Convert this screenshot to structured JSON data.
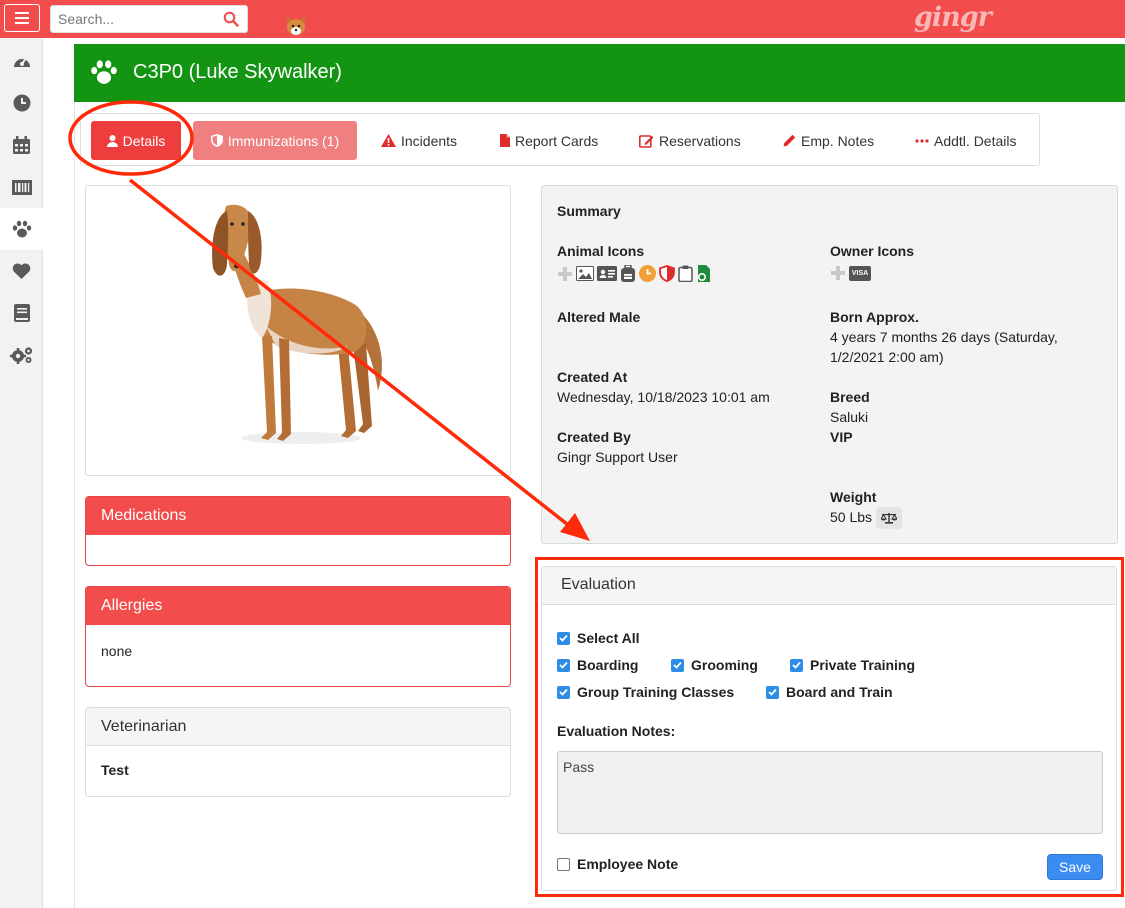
{
  "topbar": {
    "search_placeholder": "Search...",
    "logo_text": "gingr",
    "accent_color": "#f24c4c"
  },
  "sidebar": {
    "items": [
      {
        "icon": "dashboard-icon"
      },
      {
        "icon": "clock-icon"
      },
      {
        "icon": "calendar-icon"
      },
      {
        "icon": "barcode-icon"
      },
      {
        "icon": "paw-icon",
        "active": true
      },
      {
        "icon": "heart-icon"
      },
      {
        "icon": "book-icon"
      },
      {
        "icon": "gears-icon"
      }
    ]
  },
  "header": {
    "title": "C3P0 (Luke Skywalker)",
    "color": "#139513"
  },
  "tabs": [
    {
      "label": "Details",
      "icon": "user-icon",
      "active": true
    },
    {
      "label": "Immunizations (1)",
      "icon": "shield-icon"
    },
    {
      "label": "Incidents",
      "icon": "warning-icon"
    },
    {
      "label": "Report Cards",
      "icon": "file-icon"
    },
    {
      "label": "Reservations",
      "icon": "edit-icon"
    },
    {
      "label": "Emp. Notes",
      "icon": "pencil-icon"
    },
    {
      "label": "Addtl. Details",
      "icon": "ellipsis-icon"
    }
  ],
  "panels": {
    "medications": {
      "title": "Medications",
      "body": ""
    },
    "allergies": {
      "title": "Allergies",
      "body": "none"
    },
    "veterinarian": {
      "title": "Veterinarian",
      "body": "Test"
    }
  },
  "summary": {
    "title": "Summary",
    "animal_icons_label": "Animal Icons",
    "owner_icons_label": "Owner Icons",
    "owner_card_text": "VISA",
    "altered": "Altered Male",
    "born_label": "Born Approx.",
    "born_line1": "4 years 7 months 26 days (Saturday,",
    "born_line2": "1/2/2021 2:00 am)",
    "created_at_label": "Created At",
    "created_at": "Wednesday, 10/18/2023 10:01 am",
    "breed_label": "Breed",
    "breed": "Saluki",
    "vip_label": "VIP",
    "created_by_label": "Created By",
    "created_by": "Gingr Support User",
    "weight_label": "Weight",
    "weight": "50 Lbs"
  },
  "evaluation": {
    "title": "Evaluation",
    "select_all": "Select All",
    "options": [
      {
        "label": "Boarding",
        "checked": true
      },
      {
        "label": "Grooming",
        "checked": true
      },
      {
        "label": "Private Training",
        "checked": true
      },
      {
        "label": "Group Training Classes",
        "checked": true
      },
      {
        "label": "Board and Train",
        "checked": true
      }
    ],
    "notes_label": "Evaluation Notes:",
    "notes_value": "Pass",
    "employee_note": "Employee Note",
    "employee_note_checked": false,
    "save_label": "Save"
  },
  "annotation_color": "#ff2a0a"
}
